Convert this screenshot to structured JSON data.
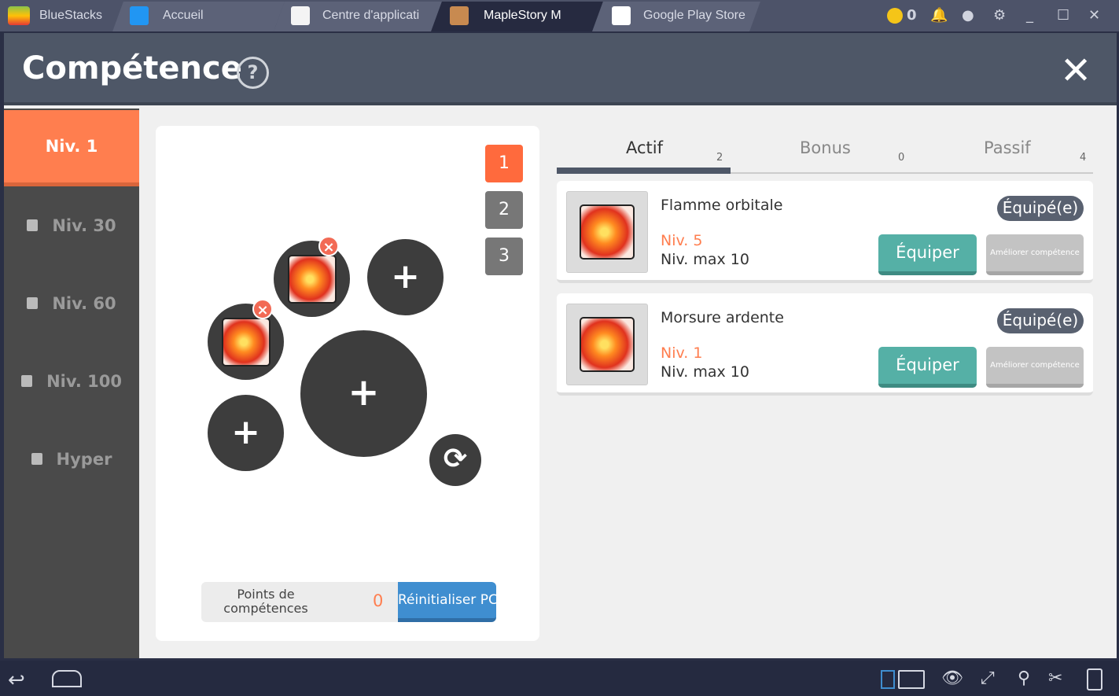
{
  "titlebar": {
    "app": "BlueStacks",
    "tabs": [
      {
        "label": "Accueil"
      },
      {
        "label": "Centre d'applicati"
      },
      {
        "label": "MapleStory M",
        "active": true
      },
      {
        "label": "Google Play Store"
      }
    ],
    "coins": "0"
  },
  "header": {
    "title": "Compétence",
    "help": "?",
    "close": "✕"
  },
  "sidebar": {
    "items": [
      {
        "label": "Niv. 1",
        "active": true
      },
      {
        "label": "Niv. 30",
        "locked": true
      },
      {
        "label": "Niv. 60",
        "locked": true
      },
      {
        "label": "Niv. 100",
        "locked": true
      },
      {
        "label": "Hyper",
        "locked": true
      }
    ]
  },
  "presets": [
    "1",
    "2",
    "3"
  ],
  "skill_points": {
    "label": "Points de compétences",
    "value": "0",
    "reset": "Réinitialiser PC"
  },
  "tabs": [
    {
      "label": "Actif",
      "count": "2",
      "active": true
    },
    {
      "label": "Bonus",
      "count": "0"
    },
    {
      "label": "Passif",
      "count": "4"
    }
  ],
  "skills": [
    {
      "name": "Flamme orbitale",
      "level": "Niv. 5",
      "max": "Niv. max 10",
      "badge": "Équipé(e)",
      "equip": "Équiper",
      "upgrade": "Améliorer compétence"
    },
    {
      "name": "Morsure ardente",
      "level": "Niv. 1",
      "max": "Niv. max 10",
      "badge": "Équipé(e)",
      "equip": "Équiper",
      "upgrade": "Améliorer compétence"
    }
  ],
  "colors": {
    "accent": "#ff7e4f",
    "equip": "#55b0a6",
    "reset": "#3f8ed0"
  }
}
